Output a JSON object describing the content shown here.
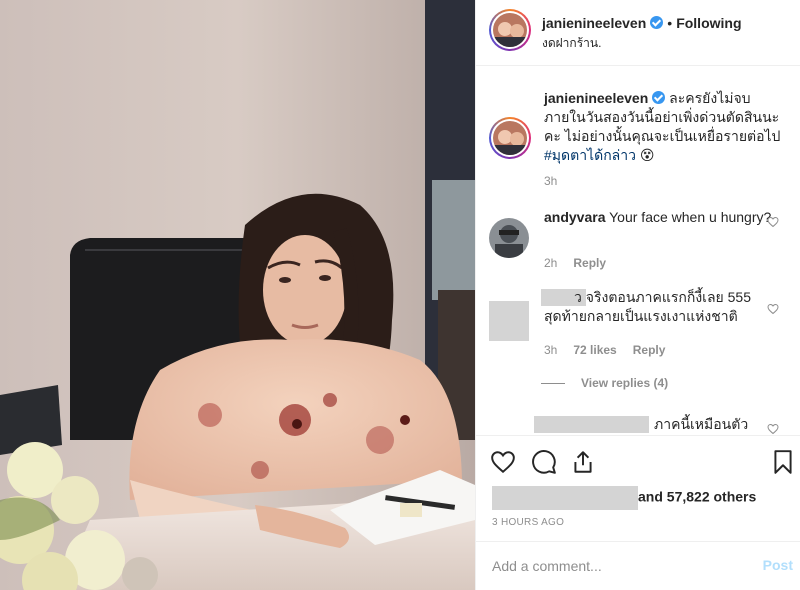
{
  "header": {
    "username": "janienineeleven",
    "separator": "•",
    "follow_state": "Following",
    "location": "งดฝากร้าน."
  },
  "caption": {
    "username": "janienineeleven",
    "text": "ละครยังไม่จบภายในวันสองวันนี้อย่าเพิ่งด่วนตัดสินนะคะ ไม่อย่างนั้นคุณจะเป็นเหยื่อรายต่อไป",
    "hashtag": "#มุดตาได้กล่าว",
    "emoji": "😵",
    "time": "3h"
  },
  "comments": [
    {
      "username": "andyvara",
      "text": "Your face when u hungry?",
      "time": "2h",
      "reply_label": "Reply"
    },
    {
      "username_fragment": "ว",
      "text": "จริงตอนภาคแรกก็งี้เลย 555 สุดท้ายกลายเป็นแรงเงาแห่งชาติ",
      "time": "3h",
      "likes": "72 likes",
      "reply_label": "Reply",
      "view_replies": "View replies (4)"
    },
    {
      "text_fragment": "ภาคนี้เหมือนตัว"
    }
  ],
  "likes": {
    "suffix": "and 57,822 others"
  },
  "timestamp": "3 HOURS AGO",
  "add_comment": {
    "placeholder": "Add a comment...",
    "post_label": "Post"
  },
  "colors": {
    "verified": "#3897f0",
    "hashtag": "#003569",
    "post_disabled": "#b2dffc",
    "muted": "#8e8e8e"
  }
}
